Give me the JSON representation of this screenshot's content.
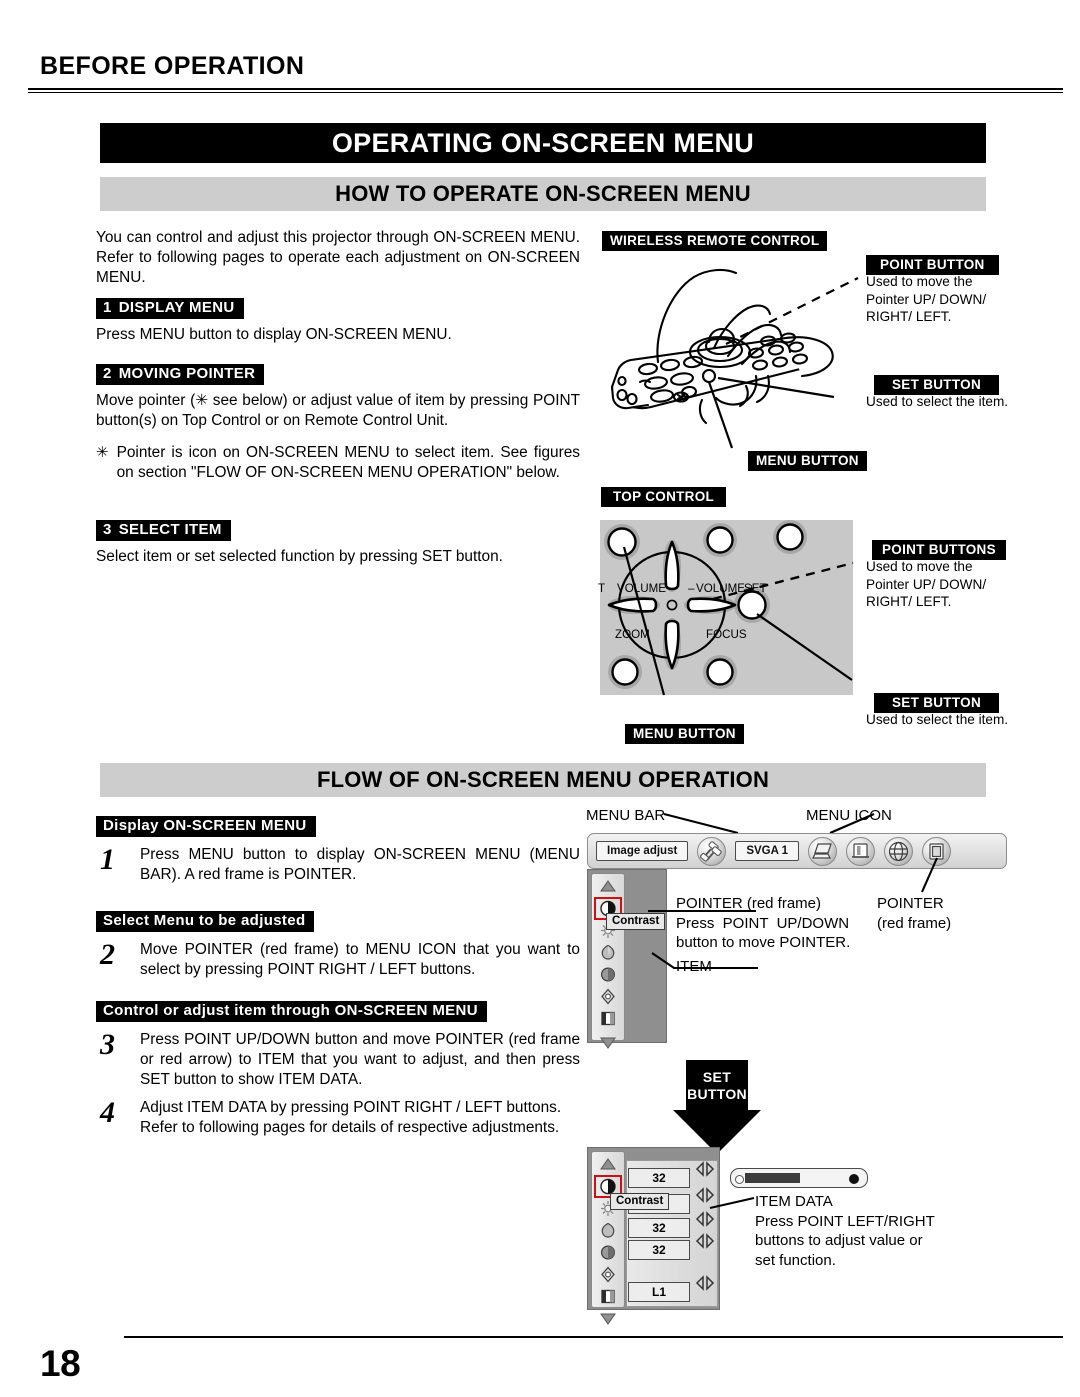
{
  "document": {
    "running_head": "BEFORE OPERATION",
    "page_number": "18"
  },
  "banners": {
    "main_title": "OPERATING ON-SCREEN MENU",
    "section_how": "HOW TO OPERATE ON-SCREEN MENU",
    "section_flow": "FLOW OF ON-SCREEN MENU OPERATION"
  },
  "how_to": {
    "intro": "You can control and adjust this projector through ON-SCREEN MENU.  Refer to following pages to operate each adjustment on ON-SCREEN MENU.",
    "steps": [
      {
        "num": "1",
        "title": "DISPLAY MENU",
        "body": "Press MENU button to display ON-SCREEN MENU."
      },
      {
        "num": "2",
        "title": "MOVING POINTER",
        "body": "Move pointer (✳ see below) or adjust value of item by pressing POINT button(s) on Top Control or on Remote Control Unit."
      },
      {
        "num": "3",
        "title": "SELECT ITEM",
        "body": "Select item or set selected function by pressing SET button."
      }
    ],
    "note_marker": "✳",
    "note": "Pointer is icon on ON-SCREEN MENU to select item.  See figures on section \"FLOW OF ON-SCREEN MENU OPERATION\" below."
  },
  "remote_figure": {
    "title": "WIRELESS REMOTE CONTROL",
    "callouts": [
      {
        "label": "POINT BUTTON",
        "desc": "Used to move the\nPointer UP/ DOWN/\nRIGHT/ LEFT."
      },
      {
        "label": "SET BUTTON",
        "desc": "Used to select the item."
      },
      {
        "label": "MENU BUTTON",
        "desc": ""
      }
    ]
  },
  "top_control_figure": {
    "title": "TOP CONTROL",
    "button_labels": {
      "volume_minus": "VOLUME –",
      "volume_plus": "VOLUME +",
      "zoom": "ZOOM",
      "focus": "FOCUS",
      "set": "SET"
    },
    "callouts": [
      {
        "label": "POINT BUTTONS",
        "desc": "Used to move the\nPointer UP/ DOWN/\nRIGHT/ LEFT."
      },
      {
        "label": "SET BUTTON",
        "desc": "Used to select the item."
      },
      {
        "label": "MENU BUTTON",
        "desc": ""
      }
    ]
  },
  "flow": {
    "steps": [
      {
        "num": "1",
        "heading": "Display ON-SCREEN MENU",
        "body": "Press MENU button to display ON-SCREEN MENU (MENU BAR).  A red frame is POINTER."
      },
      {
        "num": "2",
        "heading": "Select Menu to be adjusted",
        "body": "Move POINTER (red frame) to MENU ICON that you want to select by pressing POINT RIGHT / LEFT buttons."
      },
      {
        "num": "3",
        "heading": "Control or adjust item through ON-SCREEN MENU",
        "body": "Press POINT UP/DOWN button and move POINTER (red frame or red arrow) to ITEM that you want to adjust, and then press SET button to show ITEM DATA."
      },
      {
        "num": "4",
        "heading": "",
        "body": "Adjust ITEM DATA by pressing POINT RIGHT / LEFT buttons.\nRefer to following pages for details of respective adjustments."
      }
    ]
  },
  "osd_figure_1": {
    "callout_menu_bar": "MENU BAR",
    "callout_menu_icon": "MENU ICON",
    "menu_bar": {
      "title_label": "Image adjust",
      "system_label": "SVGA 1",
      "icons": [
        "connectors-icon",
        "computer-icon",
        "screen-icon",
        "globe-icon",
        "window-icon"
      ]
    },
    "sidebar_icons": [
      "scroll-up-arrow-icon",
      "contrast-icon",
      "brightness-icon",
      "color-icon",
      "tint-icon",
      "sharpness-icon",
      "gamma-icon",
      "scroll-down-arrow-icon"
    ],
    "tooltip": "Contrast",
    "annotations": {
      "pointer_red_frame": "POINTER (red frame)\nPress  POINT  UP/DOWN\nbutton to move POINTER.",
      "item": "ITEM",
      "pointer_right": "POINTER\n(red frame)"
    }
  },
  "set_button_arrow": {
    "line1": "SET",
    "line2": "BUTTON"
  },
  "osd_figure_2": {
    "sidebar_icons": [
      "scroll-up-arrow-icon",
      "contrast-icon",
      "brightness-icon",
      "color-icon",
      "tint-icon",
      "sharpness-icon",
      "gamma-icon",
      "scroll-down-arrow-icon"
    ],
    "tooltip": "Contrast",
    "values": [
      "32",
      "",
      "32",
      "32",
      "L1"
    ],
    "slider": {
      "value": 32,
      "max": 63
    },
    "annotation": "ITEM DATA\nPress POINT LEFT/RIGHT\nbuttons to adjust value or\nset function."
  },
  "colors": {
    "banner_black": "#000000",
    "banner_gray": "#cdcdcd",
    "panel_gray": "#8f8f8f",
    "pointer_red": "#d01010"
  }
}
